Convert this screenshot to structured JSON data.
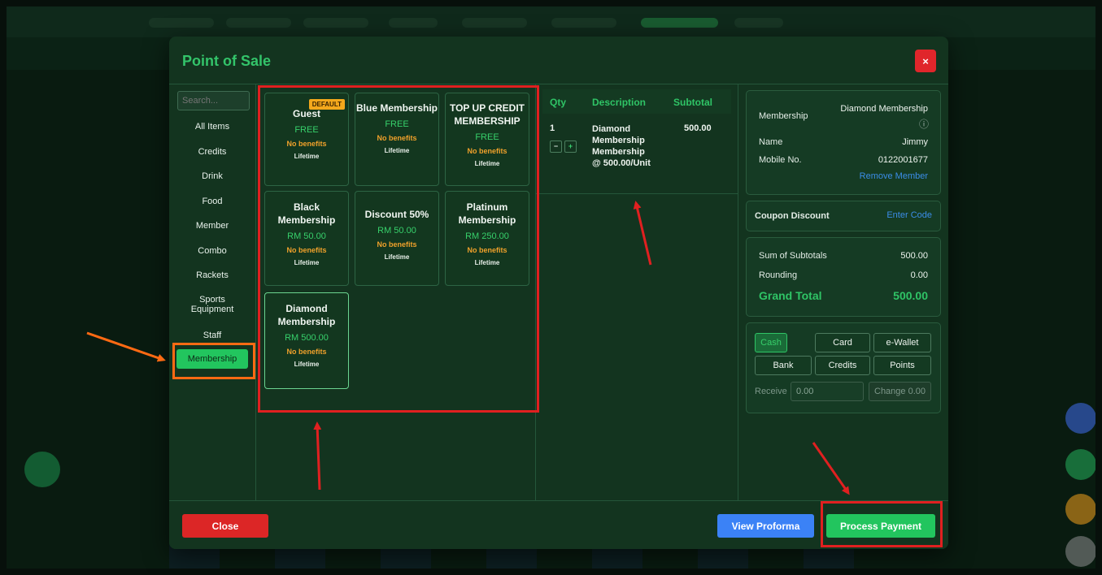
{
  "modal": {
    "title": "Point of Sale",
    "close_x": "×"
  },
  "categories": {
    "search_placeholder": "Search...",
    "items": [
      "All Items",
      "Credits",
      "Drink",
      "Food",
      "Member",
      "Combo",
      "Rackets",
      "Sports\nEquipment",
      "Staff",
      "Membership"
    ],
    "active": "Membership"
  },
  "products": [
    {
      "name": "Guest",
      "badge": "DEFAULT",
      "price": "FREE",
      "benefit": "No benefits",
      "period": "Lifetime"
    },
    {
      "name": "Blue Membership",
      "price": "FREE",
      "benefit": "No benefits",
      "period": "Lifetime"
    },
    {
      "name": "TOP UP CREDIT MEMBERSHIP",
      "price": "FREE",
      "benefit": "No benefits",
      "period": "Lifetime"
    },
    {
      "name": "Black Membership",
      "price": "RM 50.00",
      "benefit": "No benefits",
      "period": "Lifetime"
    },
    {
      "name": "Discount 50%",
      "price": "RM 50.00",
      "benefit": "No benefits",
      "period": "Lifetime"
    },
    {
      "name": "Platinum Membership",
      "price": "RM 250.00",
      "benefit": "No benefits",
      "period": "Lifetime"
    },
    {
      "name": "Diamond Membership",
      "price": "RM 500.00",
      "benefit": "No benefits",
      "period": "Lifetime"
    }
  ],
  "cart": {
    "headers": {
      "qty": "Qty",
      "description": "Description",
      "subtotal": "Subtotal"
    },
    "rows": [
      {
        "qty": "1",
        "description": "Diamond Membership Membership @ 500.00/Unit",
        "subtotal": "500.00",
        "minus": "−",
        "plus": "+"
      }
    ]
  },
  "member": {
    "membership_label": "Membership",
    "membership_value": "Diamond Membership",
    "info_icon": "ⓘ",
    "name_label": "Name",
    "name_value": "Jimmy",
    "mobile_label": "Mobile No.",
    "mobile_value": "0122001677",
    "remove_link": "Remove Member"
  },
  "coupon": {
    "label": "Coupon Discount",
    "link": "Enter Code"
  },
  "totals": {
    "sum_label": "Sum of Subtotals",
    "sum_value": "500.00",
    "rounding_label": "Rounding",
    "rounding_value": "0.00",
    "grand_label": "Grand Total",
    "grand_value": "500.00"
  },
  "payment": {
    "methods": [
      "Cash",
      "Card",
      "e-Wallet",
      "Bank",
      "Credits",
      "Points"
    ],
    "active": "Cash",
    "receive_label": "Receive",
    "receive_value": "0.00",
    "change_label": "Change",
    "change_value": "0.00"
  },
  "footer": {
    "close": "Close",
    "view_proforma": "View Proforma",
    "process_payment": "Process Payment"
  },
  "colors": {
    "accent_green": "#22c55e",
    "danger_red": "#e0262b",
    "info_blue": "#3b82f6",
    "annotation_red": "#e02020",
    "annotation_orange": "#ff6a13"
  }
}
